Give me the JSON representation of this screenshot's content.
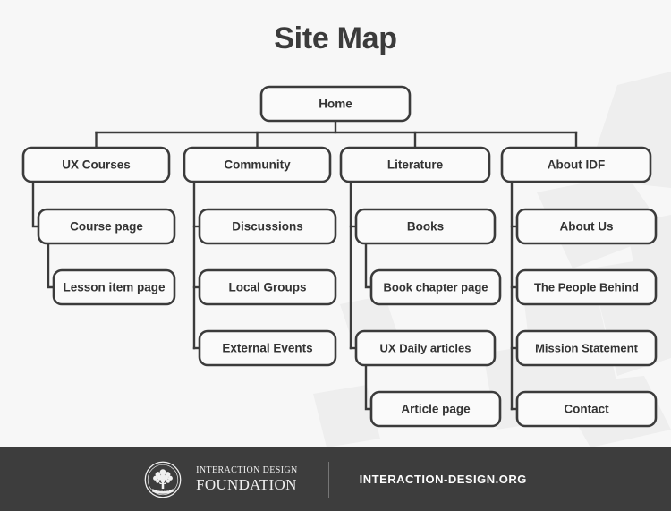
{
  "title": "Site Map",
  "colors": {
    "background": "#f7f7f7",
    "node_fill": "#fafafa",
    "node_stroke": "#3b3b3b",
    "text": "#333333",
    "footer_background": "#3d3d3d",
    "footer_text": "#fcfcfc"
  },
  "diagram": {
    "root": {
      "label": "Home"
    },
    "columns": [
      {
        "label": "UX Courses",
        "layout": "cascade",
        "children": [
          {
            "label": "Course page"
          },
          {
            "label": "Lesson item page"
          }
        ]
      },
      {
        "label": "Community",
        "layout": "spine",
        "children": [
          {
            "label": "Discussions"
          },
          {
            "label": "Local Groups"
          },
          {
            "label": "External Events"
          }
        ]
      },
      {
        "label": "Literature",
        "layout": "spine-nested",
        "children": [
          {
            "label": "Books",
            "children": [
              {
                "label": "Book chapter page"
              }
            ]
          },
          {
            "label": "UX Daily articles",
            "children": [
              {
                "label": "Article page"
              }
            ]
          }
        ]
      },
      {
        "label": "About IDF",
        "layout": "spine",
        "children": [
          {
            "label": "About Us"
          },
          {
            "label": "The People Behind"
          },
          {
            "label": "Mission Statement"
          },
          {
            "label": "Contact"
          }
        ]
      }
    ]
  },
  "footer": {
    "seal_icon": "tree-seal-icon",
    "seal_established": "Est. 2002",
    "brand_line1": "INTERACTION DESIGN",
    "brand_line2": "FOUNDATION",
    "url": "INTERACTION-DESIGN.ORG"
  }
}
